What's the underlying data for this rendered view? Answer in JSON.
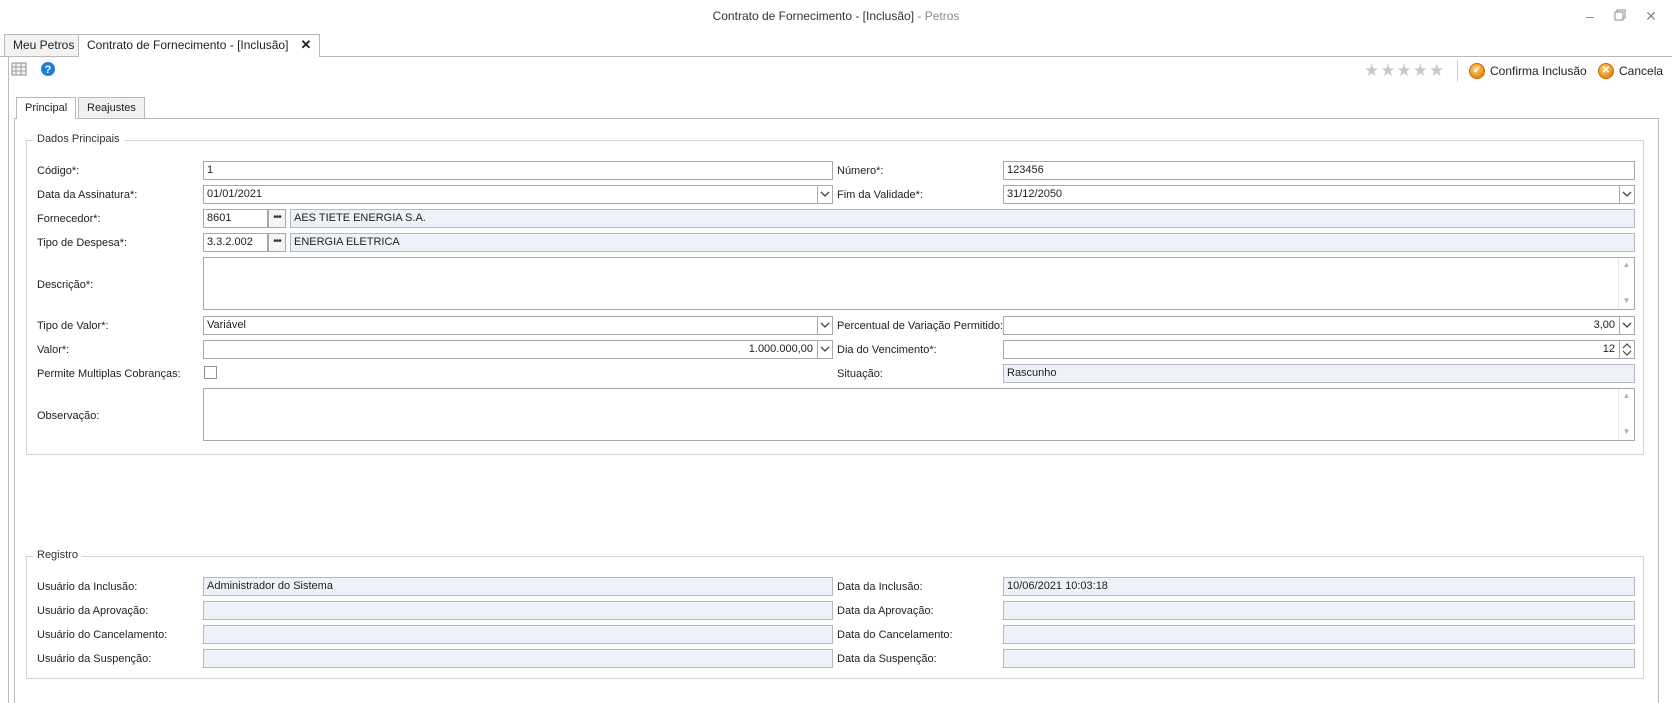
{
  "window": {
    "title": "Contrato de Fornecimento - [Inclusão]",
    "app_suffix": " - Petros"
  },
  "doc_tabs": [
    {
      "label": "Meu Petros"
    },
    {
      "label": "Contrato de Fornecimento - [Inclusão]"
    }
  ],
  "toolbar": {
    "confirm_label": "Confirma Inclusão",
    "cancel_label": "Cancela",
    "rating": 0,
    "rating_max": 5
  },
  "page_tabs": [
    {
      "label": "Principal"
    },
    {
      "label": "Reajustes"
    }
  ],
  "dados": {
    "title": "Dados Principais",
    "codigo_label": "Código*:",
    "codigo_value": "1",
    "numero_label": "Número*:",
    "numero_value": "123456",
    "data_assinatura_label": "Data da Assinatura*:",
    "data_assinatura_value": "01/01/2021",
    "fim_validade_label": "Fim da Validade*:",
    "fim_validade_value": "31/12/2050",
    "fornecedor_label": "Fornecedor*:",
    "fornecedor_code": "8601",
    "fornecedor_name": "AES TIETE ENERGIA S.A.",
    "tipo_despesa_label": "Tipo de Despesa*:",
    "tipo_despesa_code": "3.3.2.002",
    "tipo_despesa_name": "ENERGIA ELETRICA",
    "descricao_label": "Descrição*:",
    "descricao_value": "",
    "tipo_valor_label": "Tipo de Valor*:",
    "tipo_valor_value": "Variável",
    "percentual_label": "Percentual de Variação Permitido:",
    "percentual_value": "3,00",
    "valor_label": "Valor*:",
    "valor_value": "1.000.000,00",
    "dia_vencimento_label": "Dia do Vencimento*:",
    "dia_vencimento_value": "12",
    "multiplas_label": "Permite Multiplas Cobranças:",
    "multiplas_checked": false,
    "situacao_label": "Situação:",
    "situacao_value": "Rascunho",
    "observacao_label": "Observação:",
    "observacao_value": ""
  },
  "registro": {
    "title": "Registro",
    "usuario_inclusao_label": "Usuário da Inclusão:",
    "usuario_inclusao_value": "Administrador do Sistema",
    "data_inclusao_label": "Data da Inclusão:",
    "data_inclusao_value": "10/06/2021 10:03:18",
    "usuario_aprovacao_label": "Usuário da Aprovação:",
    "usuario_aprovacao_value": "",
    "data_aprovacao_label": "Data da Aprovação:",
    "data_aprovacao_value": "",
    "usuario_cancelamento_label": "Usuário do Cancelamento:",
    "usuario_cancelamento_value": "",
    "data_cancelamento_label": "Data do Cancelamento:",
    "data_cancelamento_value": "",
    "usuario_suspensao_label": "Usuário da Suspenção:",
    "usuario_suspensao_value": "",
    "data_suspensao_label": "Data da Suspenção:",
    "data_suspensao_value": ""
  },
  "icons": {
    "grid": "grid-icon",
    "help": "help-icon",
    "confirm": "confirm-icon",
    "cancel": "cancel-icon",
    "minimize": "minimize-icon",
    "restore": "restore-icon",
    "close": "close-icon"
  },
  "colors": {
    "readonly_bg": "#eef1f7",
    "accent_orange": "#e98a13",
    "help_blue": "#1e7fd8"
  }
}
